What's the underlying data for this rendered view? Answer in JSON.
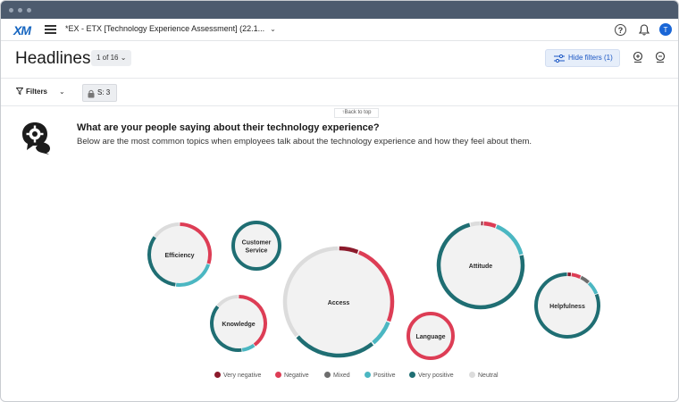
{
  "nav": {
    "logo": "XM",
    "project_title": "*EX - ETX [Technology Experience Assessment] (22.1...",
    "help_glyph": "?",
    "avatar_initial": "T"
  },
  "header": {
    "title": "Headlines",
    "pager": "1 of 16",
    "hide_filters": "Hide filters (1)"
  },
  "filterbar": {
    "filters_label": "Filters",
    "chip_label": "S: 3"
  },
  "back_to_top": "Back to top",
  "headline": {
    "title": "What are your people saying about their technology experience?",
    "subtitle": "Below are the most common topics when employees talk about the technology experience and how they feel about them."
  },
  "colors": {
    "very_negative": "#8b1a2b",
    "negative": "#dd3d55",
    "mixed": "#6d6d6d",
    "positive": "#4bb7c2",
    "very_positive": "#1f6e73",
    "neutral": "#dcdcdc",
    "bubble_fill": "#f2f2f2",
    "accent": "#1a56c4"
  },
  "legend": [
    {
      "key": "very_negative",
      "label": "Very negative"
    },
    {
      "key": "negative",
      "label": "Negative"
    },
    {
      "key": "mixed",
      "label": "Mixed"
    },
    {
      "key": "positive",
      "label": "Positive"
    },
    {
      "key": "very_positive",
      "label": "Very positive"
    },
    {
      "key": "neutral",
      "label": "Neutral"
    }
  ],
  "topics": [
    {
      "label": "Efficiency",
      "shares": {
        "very_negative": 0,
        "negative": 0.3,
        "mixed": 0,
        "positive": 0.22,
        "very_positive": 0.33,
        "neutral": 0.15
      }
    },
    {
      "label": "Customer Service",
      "shares": {
        "very_negative": 0,
        "negative": 0,
        "mixed": 0,
        "positive": 0,
        "very_positive": 1.0,
        "neutral": 0
      }
    },
    {
      "label": "Knowledge",
      "shares": {
        "very_negative": 0,
        "negative": 0.4,
        "mixed": 0,
        "positive": 0.08,
        "very_positive": 0.38,
        "neutral": 0.14
      }
    },
    {
      "label": "Access",
      "shares": {
        "very_negative": 0.06,
        "negative": 0.25,
        "mixed": 0,
        "positive": 0.08,
        "very_positive": 0.25,
        "neutral": 0.36
      }
    },
    {
      "label": "Language",
      "shares": {
        "very_negative": 0,
        "negative": 1.0,
        "mixed": 0,
        "positive": 0,
        "very_positive": 0,
        "neutral": 0
      }
    },
    {
      "label": "Attitude",
      "shares": {
        "very_negative": 0.01,
        "negative": 0.05,
        "mixed": 0,
        "positive": 0.15,
        "very_positive": 0.75,
        "neutral": 0.04
      }
    },
    {
      "label": "Helpfulness",
      "shares": {
        "very_negative": 0.02,
        "negative": 0.05,
        "mixed": 0.05,
        "positive": 0.07,
        "very_positive": 0.81,
        "neutral": 0
      }
    }
  ]
}
